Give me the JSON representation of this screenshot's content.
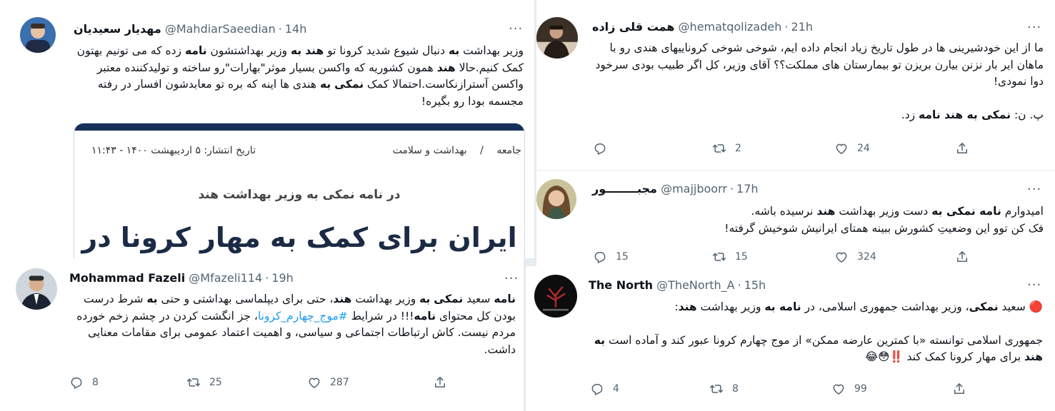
{
  "tweets": {
    "mahdiar": {
      "name": "مهدیار سعیدیان",
      "handle": "@MahdiarSaeedian",
      "time": "14h",
      "body_html": "وزیر بهداشت <b>به</b> دنبال شیوع شدید کرونا تو <b>هند</b> <b>به</b> وزیر بهداشتشون <b>نامه</b> زده که می تونیم بهتون کمک کنیم.حالا <b>هند</b> همون کشوریه که واکسن بسیار موثر\"بهارات\"رو ساخته و  تولیدکننده معتبر واکسن آسترازنکاست.احتمالا کمک <b>نمکی</b> <b>به</b> هندی ها اینه که بره تو معابدشون افسار در رفته مجسمه بودا رو بگیره!",
      "card": {
        "breadcrumb_1": "جامعه",
        "breadcrumb_sep": "/",
        "breadcrumb_2": "بهداشت و سلامت",
        "date": "تاریخ انتشار: ۵ اردیبهشت ۱۴۰۰ - ۱۱:۴۳",
        "subtitle": "در نامه نمکی به وزیر بهداشت هند",
        "headline": "ایران برای کمک به مهار کرونا در"
      }
    },
    "fazeli": {
      "name": "Mohammad Fazeli",
      "handle": "@Mfazeli114",
      "time": "19h",
      "body_html": "<b>نامه</b> سعید <b>نمکی</b> <b>به</b> وزیر بهداشت <b>هند</b>، حتی برای دیپلماسی بهداشتی و حتی <b>به</b> شرط درست بودن کل محتوای <b>نامه</b>!!! در شرایط <span class=\"hashtag\">#موج_چهارم_کرونا</span>، جز انگشت کردن در چشم زخم خورده مردم نیست. کاش ارتباطات اجتماعی و سیاسی، و اهمیت اعتماد عمومی برای مقامات معنایی داشت.",
      "replies": "8",
      "retweets": "25",
      "likes": "287"
    },
    "hemat": {
      "name": "همت قلی زاده",
      "handle": "@hematqolizadeh",
      "time": "21h",
      "body_html": "<span class=\"p\">ما از این خودشیرینی ها در طول تاریخ زیاد انجام داده ایم، شوخی شوخی کروناییهای هندی رو با ماهان ایر بار نزنن بیارن بریزن تو بیمارستان های مملکت؟؟ آقای وزیر، کل اگر طبیب بودی سرخود دوا نمودی!</span><span class=\"p\" style=\"margin-top:23px\">پ. ن: <b>نمکی به هند نامه</b> زد.</span>",
      "replies": "",
      "retweets": "2",
      "likes": "24"
    },
    "majjboorr": {
      "name": "مجبــــــــور",
      "handle": "@majjboorr",
      "time": "17h",
      "body_html": "<span class=\"p\">امیدوارم <b>نامه نمکی به</b> دست وزیر بهداشت <b>هند</b> نرسیده باشه.</span><span class=\"p\">فک کن توو این وضعیتِ کشورش ببینه همتای ایرانیش شوخیش گرفته!</span>",
      "replies": "15",
      "retweets": "15",
      "likes": "324"
    },
    "north": {
      "name": "The North",
      "handle": "@TheNorth_A",
      "time": "15h",
      "body_html": "<span class=\"p\"><span class=\"emoji\" style=\"color:#e0245e\">🔴</span> سعید <b>نمکی</b>، وزیر بهداشت جمهوری اسلامی، در <b>نامه به</b> وزیر بهداشت <b>هند</b>:</span><span class=\"p\" style=\"margin-top:23px\">جمهوری اسلامی توانسته «با کمترین عارضه ممکن» از موج چهارم کرونا عبور کند و آماده است <b>به هند</b> برای مهار کرونا کمک کند <span style=\"color:#e0245e;font-weight:bold\">‼️</span>😳😂</span>",
      "replies": "4",
      "retweets": "8",
      "likes": "99"
    }
  },
  "more_label": "···",
  "dot": "·",
  "icons": {
    "reply": "reply-icon",
    "retweet": "retweet-icon",
    "like": "like-icon",
    "share": "share-icon",
    "more": "more-icon"
  },
  "colors": {
    "text": "#0f1419",
    "secondary": "#536471",
    "link": "#1d9bf0",
    "background": "#e6ecf0",
    "card_band": "#17305a"
  }
}
